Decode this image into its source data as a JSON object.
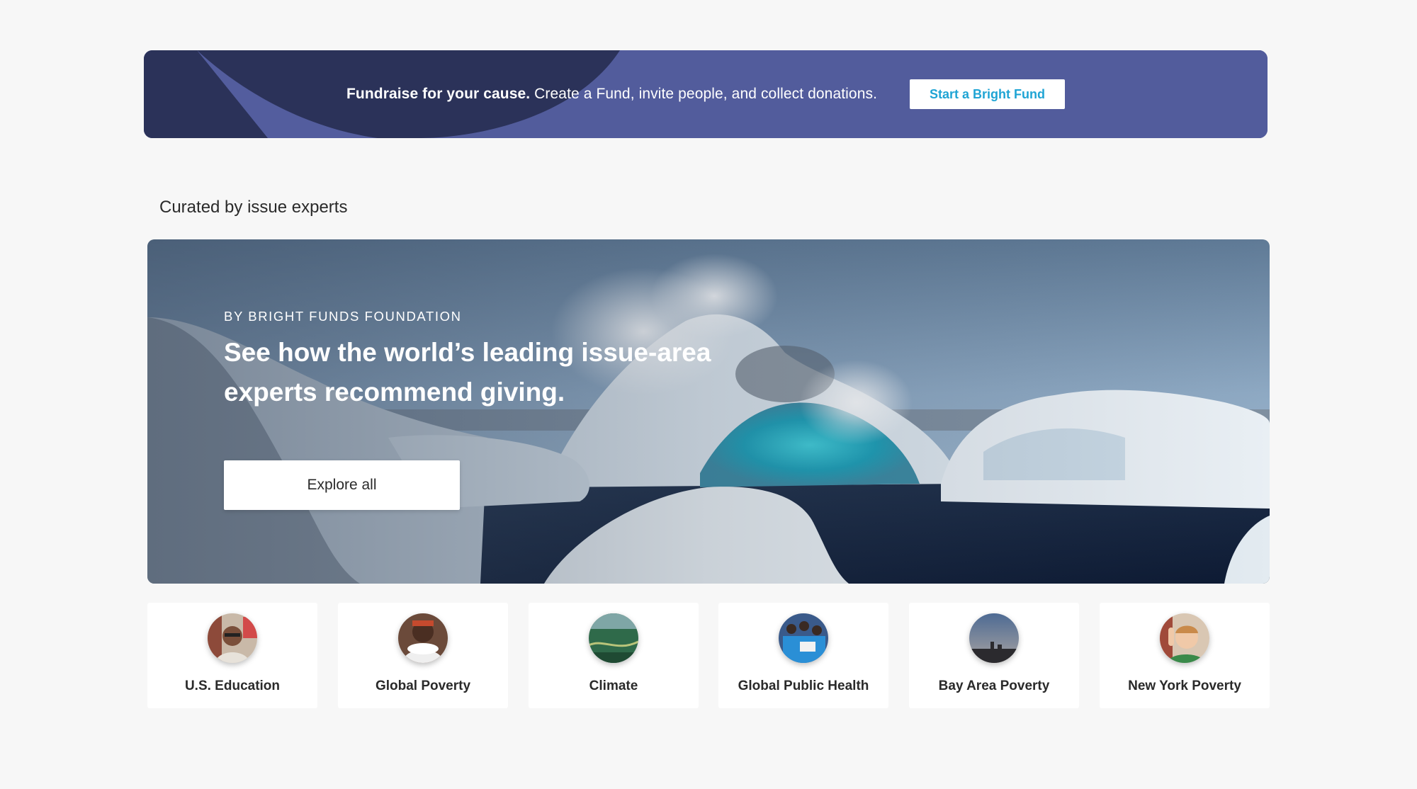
{
  "promo": {
    "lead": "Fundraise for your cause.",
    "text": " Create a Fund, invite people, and collect donations.",
    "button_label": "Start a Bright Fund",
    "colors": {
      "banner": "#525c9c",
      "dark_shape": "#2b3259",
      "button_text": "#1fa4d4"
    }
  },
  "section": {
    "title": "Curated by issue experts"
  },
  "hero": {
    "eyebrow": "BY BRIGHT FUNDS FOUNDATION",
    "heading_line1": "See how the world’s leading issue-area",
    "heading_line2": "experts recommend giving.",
    "button_label": "Explore all"
  },
  "issues": [
    {
      "label": "U.S. Education",
      "icon": "student-photo-icon"
    },
    {
      "label": "Global Poverty",
      "icon": "child-photo-icon"
    },
    {
      "label": "Climate",
      "icon": "forest-river-photo-icon"
    },
    {
      "label": "Global Public Health",
      "icon": "group-photo-icon"
    },
    {
      "label": "Bay Area Poverty",
      "icon": "city-skyline-photo-icon"
    },
    {
      "label": "New York Poverty",
      "icon": "kid-photo-icon"
    }
  ]
}
